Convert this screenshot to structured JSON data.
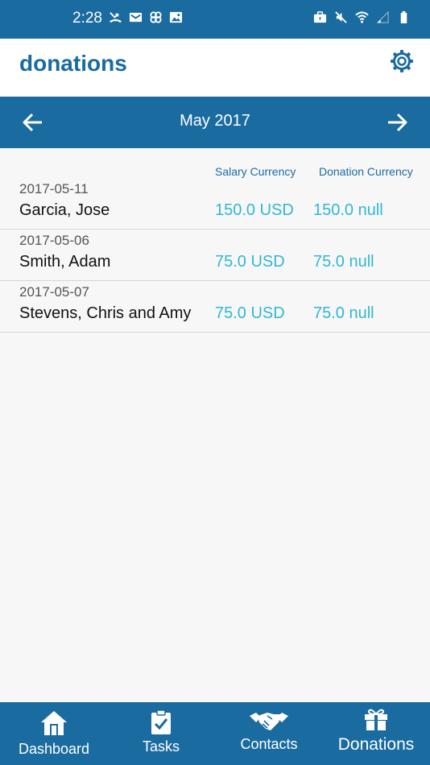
{
  "status_bar": {
    "time": "2:28"
  },
  "app_bar": {
    "title": "donations",
    "settings_icon": "gear-icon"
  },
  "month_nav": {
    "label": "May 2017",
    "prev_icon": "arrow-left-icon",
    "next_icon": "arrow-right-icon"
  },
  "list": {
    "headers": {
      "salary": "Salary Currency",
      "donation": "Donation Currency"
    },
    "rows": [
      {
        "date": "2017-05-11",
        "name": "Garcia, Jose",
        "salary": "150.0 USD",
        "donation": "150.0 null"
      },
      {
        "date": "2017-05-06",
        "name": "Smith, Adam",
        "salary": "75.0 USD",
        "donation": "75.0 null"
      },
      {
        "date": "2017-05-07",
        "name": "Stevens, Chris and Amy",
        "salary": "75.0 USD",
        "donation": "75.0 null"
      }
    ]
  },
  "bottom_nav": {
    "dashboard": "Dashboard",
    "tasks": "Tasks",
    "contacts": "Contacts",
    "donations": "Donations"
  },
  "colors": {
    "primary": "#1a6ba0",
    "accent": "#31b7d6",
    "background": "#f7f7f7"
  }
}
